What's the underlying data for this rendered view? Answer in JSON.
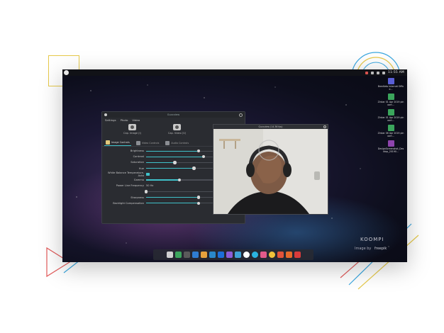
{
  "topbar": {
    "clock": "11:55 AM"
  },
  "desktop_icons": [
    {
      "label": "BrenKeto\nInternet\nOffice...",
      "color": "#5a5fd6"
    },
    {
      "label": "Zinkar 01 Apr 2019 pinoart...",
      "color": "#3ba55c"
    },
    {
      "label": "Zinkar 01 Apr 2019 pinoart...",
      "color": "#3ba55c"
    },
    {
      "label": "Zinkar 06 Apr 2019 pinoart...",
      "color": "#3ba55c"
    },
    {
      "label": "DesignScreenshot_Desktop_20190...",
      "color": "#8e44ad"
    }
  ],
  "settings_window": {
    "title": "Guvcview",
    "menu": [
      "Settings",
      "Photo",
      "Video"
    ],
    "capture": [
      "Cap. Image (I)",
      "Cap. Video (V)"
    ],
    "tabs": [
      "Image Controls",
      "Video Controls",
      "Audio Controls"
    ],
    "controls": [
      {
        "label": "Brightness",
        "kind": "slider",
        "level": 0.55
      },
      {
        "label": "Contrast",
        "kind": "slider",
        "level": 0.6
      },
      {
        "label": "Saturation",
        "kind": "slider",
        "level": 0.3
      },
      {
        "label": "Hue",
        "kind": "slider",
        "level": 0.5
      },
      {
        "label": "White Balance Temperature, Auto",
        "kind": "check"
      },
      {
        "label": "Gamma",
        "kind": "slider",
        "level": 0.35
      },
      {
        "label": "Power Line Frequency",
        "kind": "value",
        "value": "50 Hz"
      },
      {
        "label": "",
        "kind": "slider",
        "level": 0.0
      },
      {
        "label": "Sharpness",
        "kind": "slider",
        "level": 0.55
      },
      {
        "label": "Backlight Compensation",
        "kind": "slider",
        "level": 0.55
      }
    ]
  },
  "video_window": {
    "title": "Guvcview (14.36 fps)"
  },
  "watermarks": {
    "brand": "KOOMPI",
    "credit": "Image by",
    "freepik": "freepik"
  },
  "dock_colors": [
    "#d0d0d0",
    "#3ba55c",
    "#5a5a5a",
    "#2f7dd1",
    "#e6a23c",
    "#2a88c9",
    "#1c6fd8",
    "#8c5cd6",
    "#3fa1d6",
    "#ffffff",
    "#2ab4e0",
    "#e25a8a",
    "#f0c23a",
    "#e2533a",
    "#e66a2a",
    "#d83b3b"
  ]
}
